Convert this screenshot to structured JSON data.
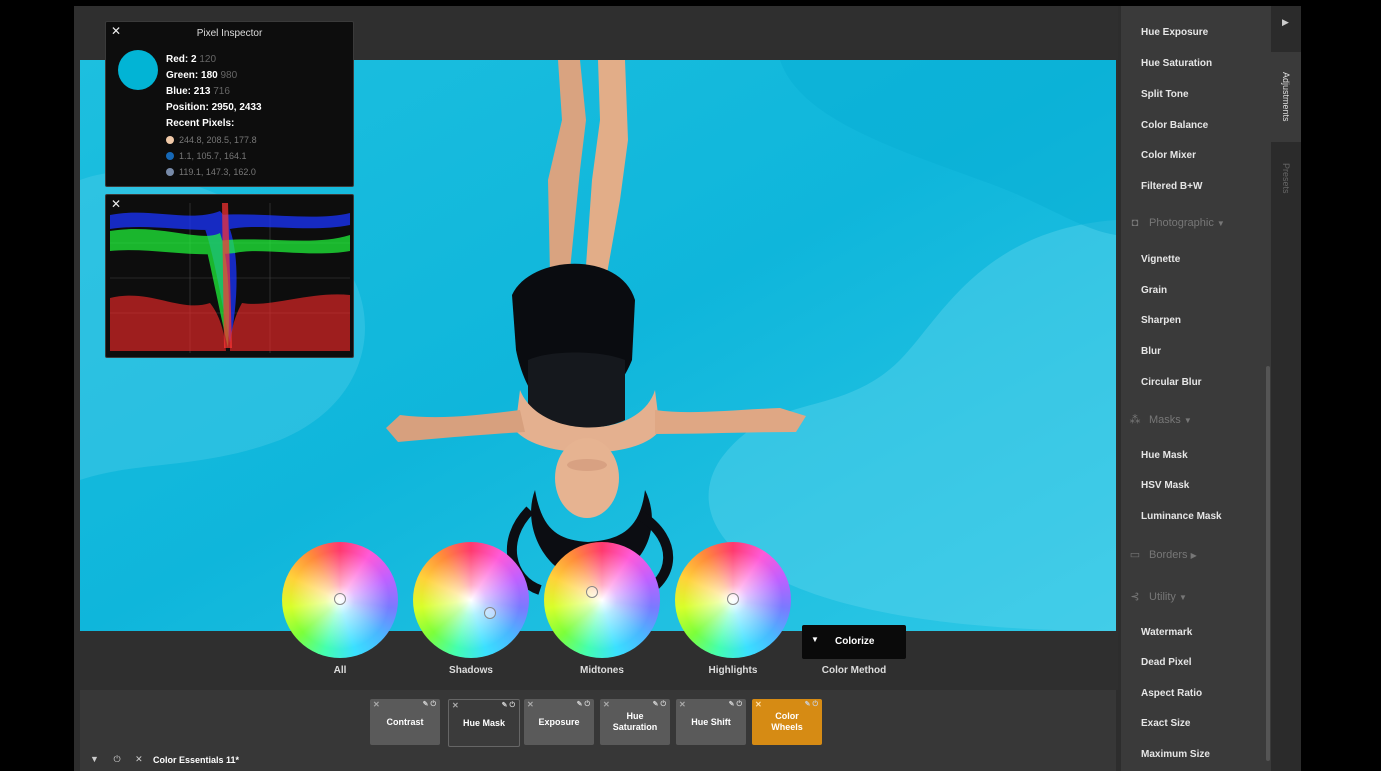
{
  "inspector": {
    "title": "Pixel Inspector",
    "red_label": "Red:",
    "red": "2",
    "red_fine": "120",
    "green_label": "Green:",
    "green": "180",
    "green_fine": "980",
    "blue_label": "Blue:",
    "blue": "213",
    "blue_fine": "716",
    "position_label": "Position:",
    "position": "2950, 2433",
    "recent_label": "Recent Pixels:",
    "recent": [
      {
        "color": "#f0c9a8",
        "text": "244.8, 208.5, 177.8"
      },
      {
        "color": "#1668b6",
        "text": "1.1, 105.7, 164.1"
      },
      {
        "color": "#778aa8",
        "text": "119.1, 147.3, 162.0"
      }
    ]
  },
  "wheels": {
    "all": "All",
    "shadows": "Shadows",
    "midtones": "Midtones",
    "highlights": "Highlights"
  },
  "color_method": {
    "label": "Color Method",
    "value": "Colorize"
  },
  "stack": [
    {
      "label": "Contrast"
    },
    {
      "label": "Hue Mask"
    },
    {
      "label": "Exposure"
    },
    {
      "label": "Hue Saturation"
    },
    {
      "label": "Hue Shift"
    },
    {
      "label": "Color Wheels"
    }
  ],
  "footer": {
    "preset_name": "Color Essentials 11*"
  },
  "sidebar": {
    "top_items": [
      "Hue Exposure",
      "Hue Saturation",
      "Split Tone",
      "Color Balance",
      "Color Mixer",
      "Filtered B+W"
    ],
    "photographic": {
      "title": "Photographic",
      "items": [
        "Vignette",
        "Grain",
        "Sharpen",
        "Blur",
        "Circular Blur"
      ]
    },
    "masks": {
      "title": "Masks",
      "items": [
        "Hue Mask",
        "HSV Mask",
        "Luminance Mask"
      ]
    },
    "borders": {
      "title": "Borders"
    },
    "utility": {
      "title": "Utility",
      "items": [
        "Watermark",
        "Dead Pixel",
        "Aspect Ratio",
        "Exact Size",
        "Maximum Size"
      ]
    }
  },
  "tabs": {
    "adjustments": "Adjustments",
    "presets": "Presets"
  },
  "colors": {
    "accent": "#d68b14",
    "pool": "#02b4d5"
  }
}
